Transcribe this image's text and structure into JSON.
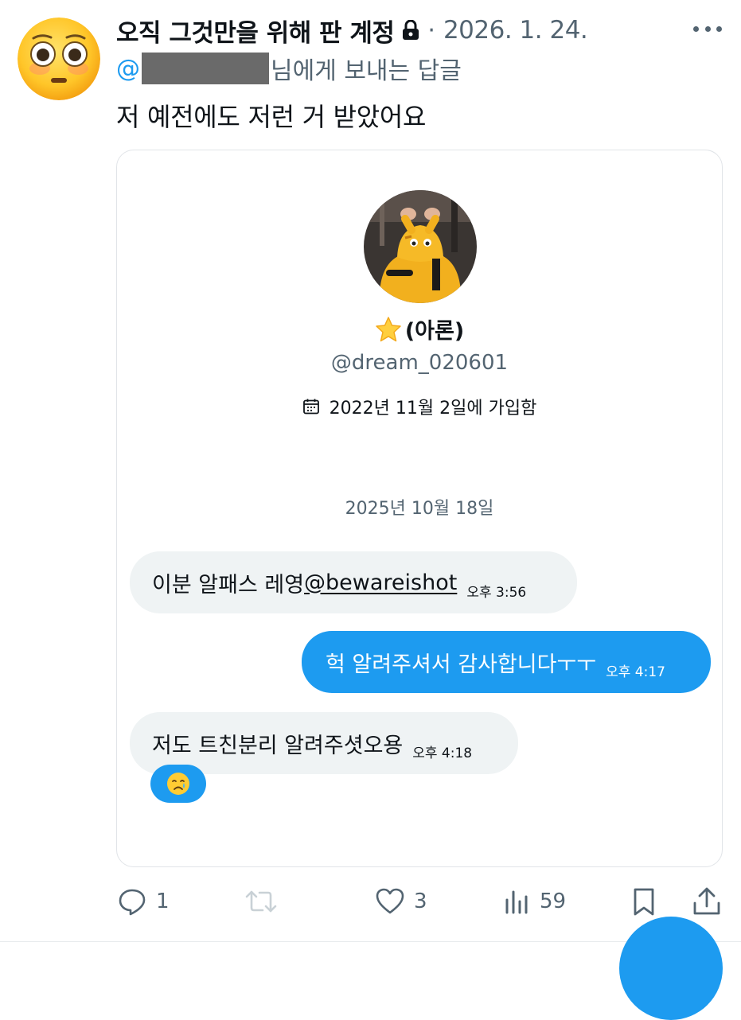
{
  "tweet": {
    "display_name": "오직 그것만을 위해 판 계정",
    "date": "2026. 1. 24.",
    "separator": "·",
    "reply_to_prefix": "@",
    "reply_to_suffix": "님에게 보내는 답글",
    "text": "저 예전에도 저런 거 받았어요",
    "icons": {
      "avatar": "flushed-face-emoji",
      "lock": "lock-icon",
      "more": "more-icon"
    }
  },
  "card": {
    "profile": {
      "name": "(아론)",
      "handle": "@dream_020601",
      "joined": "2022년 11월 2일에 가입함"
    },
    "date_divider": "2025년 10월 18일",
    "messages": [
      {
        "direction": "incoming",
        "text": "이분 알패스 레영 ",
        "mention": "@bewareishot",
        "time": "오후 3:56"
      },
      {
        "direction": "outgoing",
        "text": "헉 알려주셔서 감사합니다ㅜㅜ",
        "time": "오후 4:17"
      },
      {
        "direction": "incoming",
        "text": "저도 트친분리 알려주셧오용",
        "time": "오후 4:18",
        "reaction": "crying-face"
      }
    ]
  },
  "actions": {
    "reply_count": "1",
    "like_count": "3",
    "view_count": "59"
  },
  "colors": {
    "accent": "#1d9bf0",
    "muted_text": "#536471",
    "text": "#0f1419",
    "incoming_bubble": "#eff3f4"
  }
}
